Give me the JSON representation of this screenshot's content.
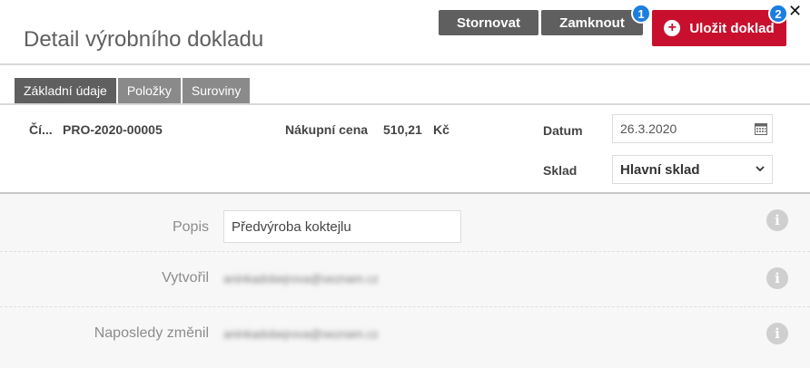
{
  "header": {
    "title": "Detail výrobního dokladu",
    "cancel_label": "Stornovat",
    "lock_label": "Zamknout",
    "save_label": "Uložit doklad",
    "badge_1": "1",
    "badge_2": "2",
    "close_glyph": "✕",
    "accent_color": "#c8102e",
    "badge_color": "#1b7fe0"
  },
  "tabs": [
    {
      "label": "Základní údaje",
      "active": true
    },
    {
      "label": "Položky",
      "active": false
    },
    {
      "label": "Suroviny",
      "active": false
    }
  ],
  "info": {
    "doc_label": "Čí...",
    "doc_number": "PRO-2020-00005",
    "price_label": "Nákupní cena",
    "price_value": "510,21",
    "price_unit": "Kč",
    "date_label": "Datum",
    "date_value": "26.3.2020",
    "warehouse_label": "Sklad",
    "warehouse_value": "Hlavní sklad"
  },
  "details": {
    "description_label": "Popis",
    "description_value": "Předvýroba koktejlu",
    "created_label": "Vytvořil",
    "created_value": "aninkadobejrova@seznam.cz",
    "modified_label": "Naposledy změnil",
    "modified_value": "aninkadobejrova@seznam.cz"
  },
  "icons": {
    "info": "info-icon",
    "calendar": "calendar-icon",
    "plus": "plus-circle-icon",
    "close": "close-icon",
    "chevron": "chevron-down-icon"
  }
}
